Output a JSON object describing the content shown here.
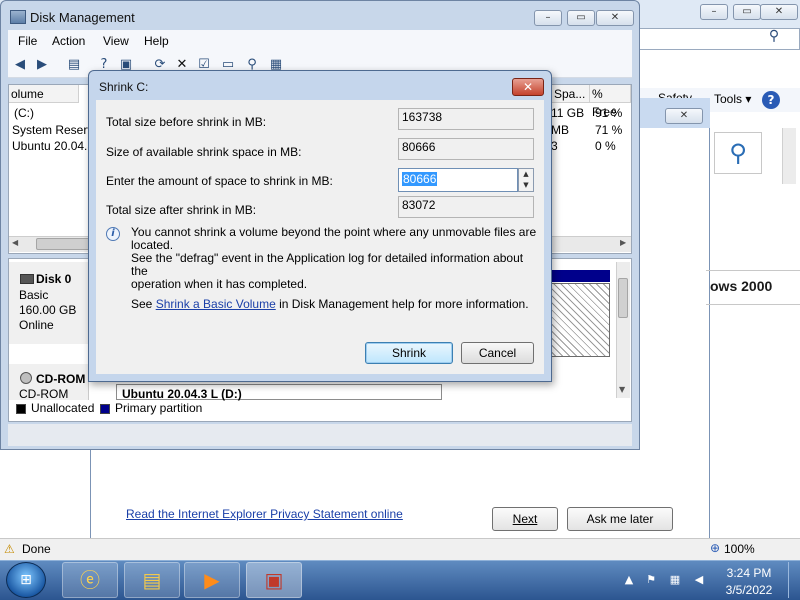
{
  "ie": {
    "toolbar": {
      "safety_label": "Safety",
      "tools_label": "Tools ▾"
    },
    "heading": "ows 2000",
    "privacy_link": "Read the Internet Explorer Privacy Statement online",
    "next_label": "Next",
    "ask_later_label": "Ask me later",
    "status": "Done",
    "zoom": "100%"
  },
  "disk_management": {
    "title": "Disk Management",
    "menu": [
      "File",
      "Action",
      "View",
      "Help"
    ],
    "columns": [
      "olume",
      "Spa...",
      "% Free"
    ],
    "volumes": [
      {
        "name": "(C:)",
        "space": "11 GB",
        "free": "91 %"
      },
      {
        "name": "System Reserv",
        "space": "MB",
        "free": "71 %"
      },
      {
        "name": "Ubuntu 20.04.3",
        "space": "3",
        "free": "0 %"
      }
    ],
    "disk0": {
      "name": "Disk 0",
      "type": "Basic",
      "size": "160.00 GB",
      "status": "Online"
    },
    "cdrom": {
      "name": "CD-ROM",
      "type": "CD-ROM",
      "volume": "Ubuntu 20.04.3 L  (D:)"
    },
    "legend": {
      "unallocated": "Unallocated",
      "primary": "Primary partition"
    },
    "colors": {
      "unallocated": "#000000",
      "primary": "#00008b"
    }
  },
  "shrink": {
    "title": "Shrink C:",
    "total_before_label": "Total size before shrink in MB:",
    "total_before_value": "163738",
    "available_label": "Size of available shrink space in MB:",
    "available_value": "80666",
    "amount_label": "Enter the amount of space to shrink in MB:",
    "amount_value": "80666",
    "total_after_label": "Total size after shrink in MB:",
    "total_after_value": "83072",
    "info_line1": "You cannot shrink a volume beyond the point where any unmovable files are located.",
    "info_line2": "See the \"defrag\" event in the Application log for detailed information about the",
    "info_line3": "operation when it has completed.",
    "see_prefix": "See ",
    "see_link": "Shrink a Basic Volume",
    "see_suffix": " in Disk Management help for more information.",
    "shrink_button": "Shrink",
    "cancel_button": "Cancel"
  },
  "taskbar": {
    "time": "3:24 PM",
    "date": "3/5/2022",
    "apps": [
      "internet-explorer",
      "windows-explorer",
      "media-player",
      "computer-management"
    ]
  }
}
